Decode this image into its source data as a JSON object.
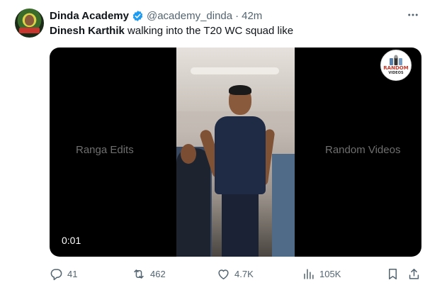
{
  "tweet": {
    "author_name": "Dinda Academy",
    "handle": "@academy_dinda",
    "separator": "·",
    "time": "42m",
    "text_bold": "Dinesh Karthik",
    "text_rest": " walking into the T20 WC squad like"
  },
  "media": {
    "watermark_left": "Ranga Edits",
    "watermark_right": "Random Videos",
    "logo_text_line1": "RANDOM",
    "logo_text_line2": "VIDEOS",
    "video_time": "0:01"
  },
  "actions": {
    "reply_count": "41",
    "retweet_count": "462",
    "like_count": "4.7K",
    "view_count": "105K"
  },
  "colors": {
    "verified": "#1d9bf0",
    "secondary_text": "#536471",
    "primary_text": "#0f1419"
  },
  "icons": [
    "verified-badge-icon",
    "more-icon",
    "reply-icon",
    "retweet-icon",
    "like-icon",
    "views-icon",
    "bookmark-icon",
    "share-icon"
  ]
}
